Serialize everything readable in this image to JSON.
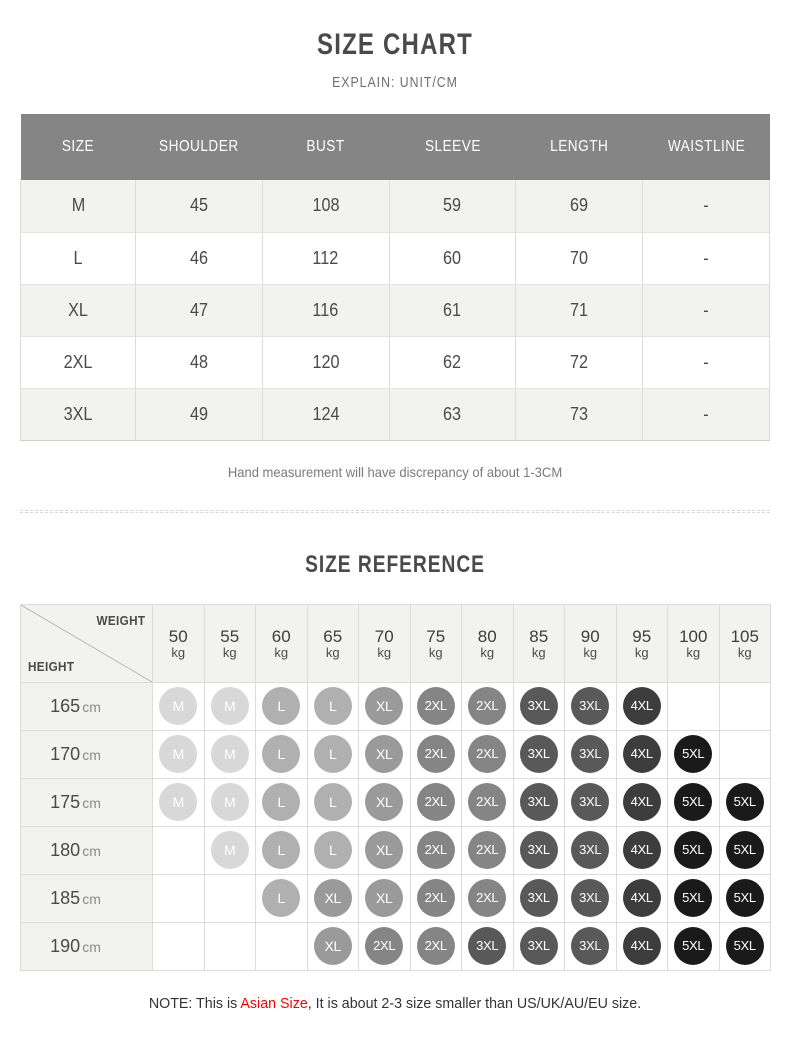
{
  "header": {
    "title": "SIZE CHART",
    "subtitle": "EXPLAIN: UNIT/CM"
  },
  "size_chart": {
    "columns": [
      "SIZE",
      "SHOULDER",
      "BUST",
      "SLEEVE",
      "LENGTH",
      "WAISTLINE"
    ],
    "rows": [
      [
        "M",
        "45",
        "108",
        "59",
        "69",
        "-"
      ],
      [
        "L",
        "46",
        "112",
        "60",
        "70",
        "-"
      ],
      [
        "XL",
        "47",
        "116",
        "61",
        "71",
        "-"
      ],
      [
        "2XL",
        "48",
        "120",
        "62",
        "72",
        "-"
      ],
      [
        "3XL",
        "49",
        "124",
        "63",
        "73",
        "-"
      ]
    ],
    "note": "Hand measurement will have discrepancy of about 1-3CM"
  },
  "reference": {
    "title": "SIZE REFERENCE",
    "corner": {
      "weight_label": "WEIGHT",
      "height_label": "HEIGHT"
    },
    "weight_unit": "kg",
    "weights": [
      "50",
      "55",
      "60",
      "65",
      "70",
      "75",
      "80",
      "85",
      "90",
      "95",
      "100",
      "105"
    ],
    "height_unit": "cm",
    "heights": [
      "165",
      "170",
      "175",
      "180",
      "185",
      "190"
    ],
    "grid": [
      [
        "M",
        "M",
        "L",
        "L",
        "XL",
        "2XL",
        "2XL",
        "3XL",
        "3XL",
        "4XL",
        "",
        ""
      ],
      [
        "M",
        "M",
        "L",
        "L",
        "XL",
        "2XL",
        "2XL",
        "3XL",
        "3XL",
        "4XL",
        "5XL",
        ""
      ],
      [
        "M",
        "M",
        "L",
        "L",
        "XL",
        "2XL",
        "2XL",
        "3XL",
        "3XL",
        "4XL",
        "5XL",
        "5XL"
      ],
      [
        "",
        "M",
        "L",
        "L",
        "XL",
        "2XL",
        "2XL",
        "3XL",
        "3XL",
        "4XL",
        "5XL",
        "5XL"
      ],
      [
        "",
        "",
        "L",
        "XL",
        "XL",
        "2XL",
        "2XL",
        "3XL",
        "3XL",
        "4XL",
        "5XL",
        "5XL"
      ],
      [
        "",
        "",
        "",
        "XL",
        "2XL",
        "2XL",
        "3XL",
        "3XL",
        "3XL",
        "4XL",
        "5XL",
        "5XL"
      ]
    ],
    "bubble_colors": {
      "M": "#d8d8d8",
      "L": "#b0b0b0",
      "XL": "#9a9a9a",
      "2XL": "#858585",
      "3XL": "#595959",
      "4XL": "#3d3d3d",
      "5XL": "#1a1a1a"
    }
  },
  "footer": {
    "prefix": "NOTE: This is ",
    "highlight": "Asian Size",
    "suffix": ", It is about 2-3 size smaller than US/UK/AU/EU size.",
    "highlight_color": "#ff0000"
  },
  "theme": {
    "header_bg": "#858585",
    "row_alt_bg": "#f2f2f0",
    "border": "#dcdcda"
  }
}
